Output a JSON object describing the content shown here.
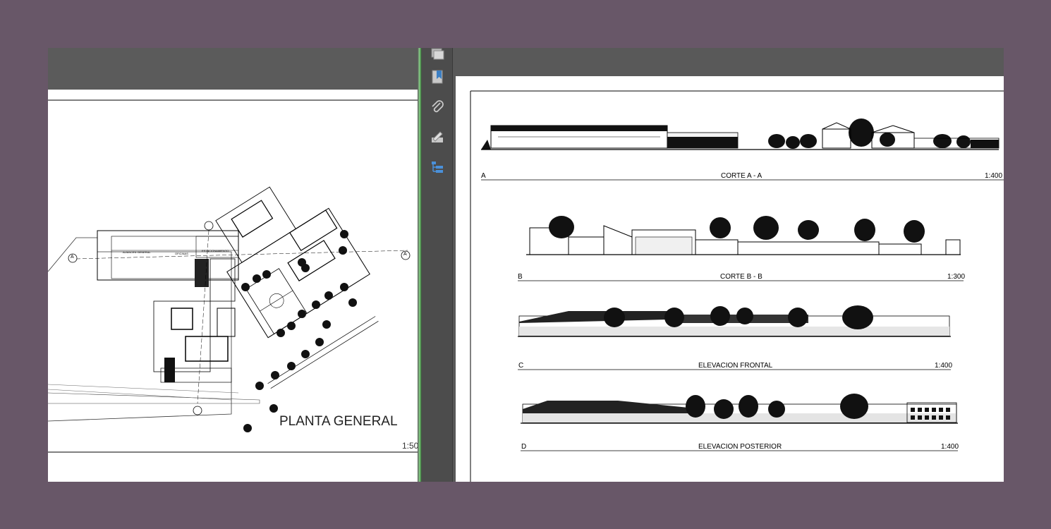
{
  "left_page": {
    "title": "PLANTA GENERAL",
    "scale": "1:50",
    "labels": {
      "almacen": "ALMACEN GENERAL",
      "oficinas": "OFICINAS",
      "estacionamiento": "ESTACIONAMIENTO",
      "marker_a": "A"
    }
  },
  "toolbar": {
    "tools": [
      "pages-icon",
      "bookmark-icon",
      "attachment-icon",
      "signature-icon",
      "layers-icon"
    ]
  },
  "right_page": {
    "sections": [
      {
        "letter": "A",
        "name": "CORTE A - A",
        "scale": "1:400"
      },
      {
        "letter": "B",
        "name": "CORTE B - B",
        "scale": "1:300"
      },
      {
        "letter": "C",
        "name": "ELEVACION FRONTAL",
        "scale": "1:400"
      },
      {
        "letter": "D",
        "name": "ELEVACION POSTERIOR",
        "scale": "1:400"
      }
    ]
  }
}
